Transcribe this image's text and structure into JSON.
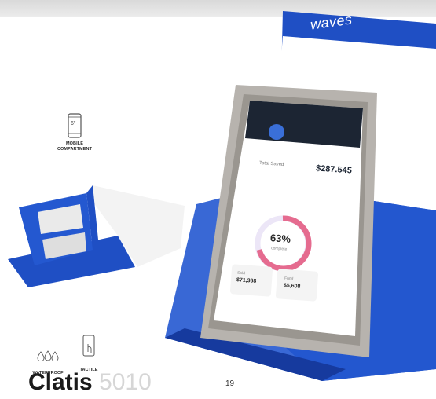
{
  "features": {
    "mobile": {
      "size_label": "6\"",
      "label_line1": "MOBILE",
      "label_line2": "COMPARTMENT"
    },
    "waterproof": {
      "label": "WATERPROOF",
      "icon": "water-drops-icon"
    },
    "tactile": {
      "label": "TACTILE",
      "icon": "touch-phone-icon"
    }
  },
  "brand": {
    "name": "waves"
  },
  "phone_screen": {
    "balance_label": "Total Saved",
    "balance_value": "$287.545",
    "percent": "63%",
    "percent_label": "complete",
    "stat1_label": "Sold",
    "stat1_value": "$71,368",
    "stat2_label": "Fund",
    "stat2_value": "$5,608"
  },
  "product": {
    "title": "Clatis",
    "code": "5010"
  },
  "page": {
    "number": "19"
  },
  "colors": {
    "blue": "#1f4fc4",
    "dark_blue": "#1536a0",
    "white": "#ffffff"
  }
}
